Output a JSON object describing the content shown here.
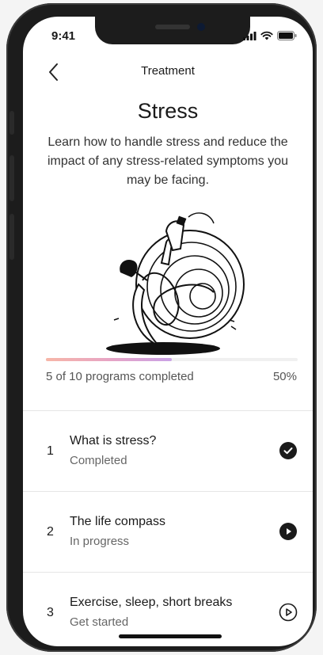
{
  "status_bar": {
    "time": "9:41"
  },
  "nav": {
    "title": "Treatment",
    "back_icon": "chevron-left-icon"
  },
  "header": {
    "title": "Stress",
    "description": "Learn how to handle stress and reduce the impact of any stress-related symptoms you may be facing."
  },
  "progress": {
    "completed": 5,
    "total": 10,
    "fraction": 0.5,
    "label": "5 of 10 programs completed",
    "percent_label": "50%"
  },
  "programs": [
    {
      "number": "1",
      "title": "What is stress?",
      "status": "Completed",
      "icon": "check-circle-icon"
    },
    {
      "number": "2",
      "title": "The life compass",
      "status": "In progress",
      "icon": "play-circle-filled-icon"
    },
    {
      "number": "3",
      "title": "Exercise, sleep, short breaks",
      "status": "Get started",
      "icon": "play-circle-outline-icon"
    }
  ],
  "colors": {
    "progress_gradient": [
      "#f7b6a7",
      "#e7a4c4",
      "#c9a2e6"
    ],
    "text_primary": "#1a1a1a",
    "text_secondary": "#666666"
  }
}
